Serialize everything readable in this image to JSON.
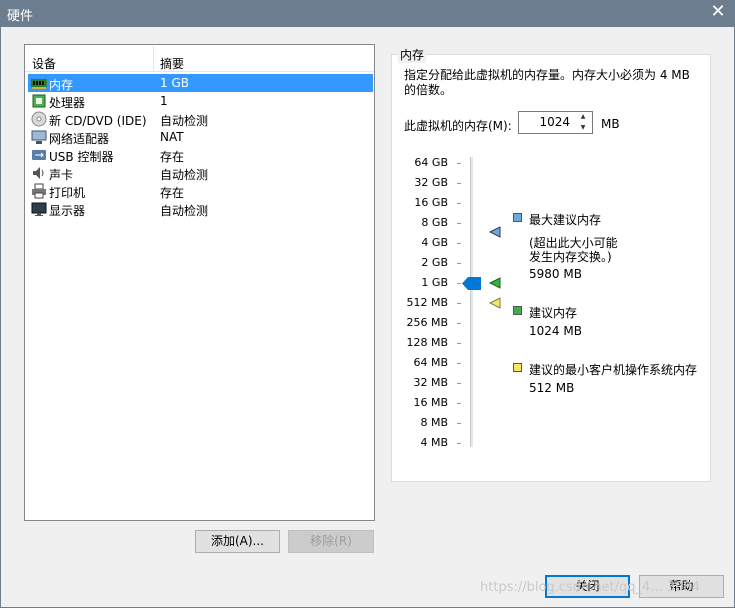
{
  "window": {
    "title": "硬件",
    "close_glyph": "✕"
  },
  "device_list": {
    "columns": [
      "设备",
      "摘要"
    ],
    "rows": [
      {
        "name": "内存",
        "summary": "1 GB",
        "icon": "memory-icon",
        "selected": true
      },
      {
        "name": "处理器",
        "summary": "1",
        "icon": "processor-icon",
        "selected": false
      },
      {
        "name": "新 CD/DVD (IDE)",
        "summary": "自动检测",
        "icon": "cd-dvd-icon",
        "selected": false
      },
      {
        "name": "网络适配器",
        "summary": "NAT",
        "icon": "network-adapter-icon",
        "selected": false
      },
      {
        "name": "USB 控制器",
        "summary": "存在",
        "icon": "usb-icon",
        "selected": false
      },
      {
        "name": "声卡",
        "summary": "自动检测",
        "icon": "sound-card-icon",
        "selected": false
      },
      {
        "name": "打印机",
        "summary": "存在",
        "icon": "printer-icon",
        "selected": false
      },
      {
        "name": "显示器",
        "summary": "自动检测",
        "icon": "display-icon",
        "selected": false
      }
    ]
  },
  "buttons": {
    "add": "添加(A)...",
    "remove": "移除(R)",
    "close": "关闭",
    "help": "帮助"
  },
  "memory": {
    "group_title": "内存",
    "description": "指定分配给此虚拟机的内存量。内存大小必须为 4 MB 的倍数。",
    "field_label": "此虚拟机的内存(M):",
    "value": "1024",
    "unit": "MB",
    "scale_labels": [
      "64 GB",
      "32 GB",
      "16 GB",
      "8 GB",
      "4 GB",
      "2 GB",
      "1 GB",
      "512 MB",
      "256 MB",
      "128 MB",
      "64 MB",
      "32 MB",
      "16 MB",
      "8 MB",
      "4 MB"
    ],
    "slider_value": "1 GB",
    "legend": {
      "max_title": "最大建议内存",
      "max_note_1": "(超出此大小可能",
      "max_note_2": "发生内存交换。)",
      "max_value": "5980 MB",
      "rec_title": "建议内存",
      "rec_value": "1024 MB",
      "min_title": "建议的最小客户机操作系统内存",
      "min_value": "512 MB"
    },
    "colors": {
      "max": "#6fa8dc",
      "rec": "#3cb043",
      "min": "#f5e663",
      "thumb": "#0078d7"
    }
  },
  "watermark": "https://blog.csdn.net/qq_4... 3084"
}
